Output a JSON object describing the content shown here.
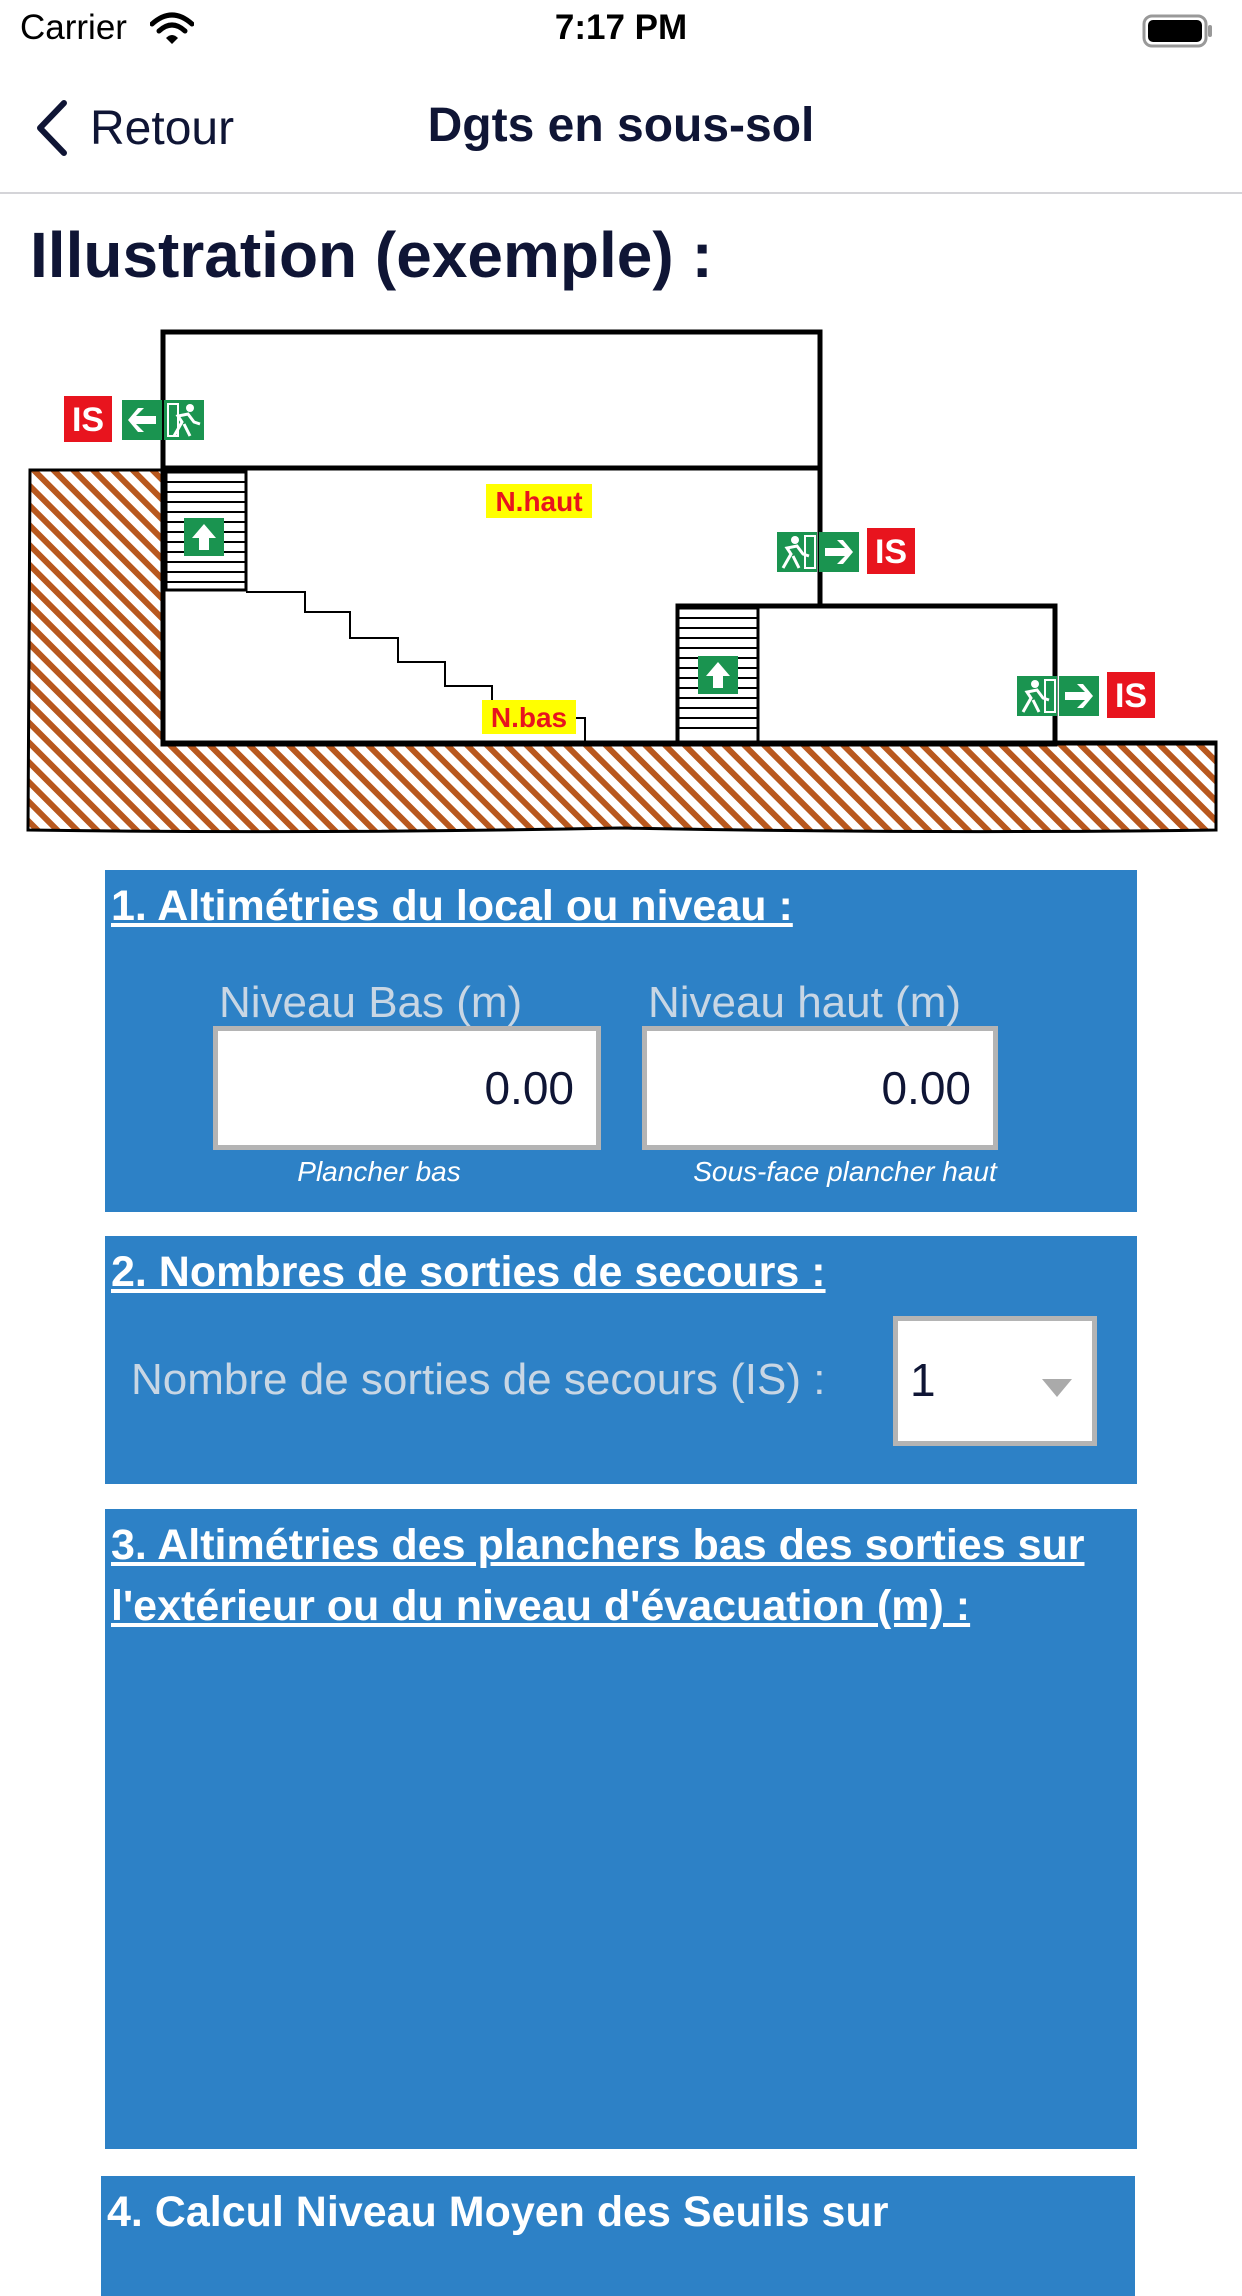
{
  "status_bar": {
    "carrier": "Carrier",
    "time": "7:17 PM"
  },
  "nav": {
    "back_label": "Retour",
    "title": "Dgts en sous-sol"
  },
  "page": {
    "section_title": "Illustration (exemple) :"
  },
  "illustration": {
    "n_haut": "N.haut",
    "n_bas": "N.bas",
    "is_label": "IS"
  },
  "section1": {
    "heading": "1. Altimétries du local ou niveau :",
    "niveau_bas": {
      "label": "Niveau Bas (m)",
      "value": "0.00",
      "hint": "Plancher bas"
    },
    "niveau_haut": {
      "label": "Niveau haut (m)",
      "value": "0.00",
      "hint": "Sous-face plancher haut"
    }
  },
  "section2": {
    "heading": "2. Nombres de sorties de secours :",
    "label": "Nombre de sorties de secours (IS) :",
    "selected": "1"
  },
  "section3": {
    "heading": "3. Altimétries des planchers bas des sorties sur l'extérieur ou du niveau d'évacuation (m) :"
  },
  "section4": {
    "heading": "4. Calcul Niveau Moyen des Seuils sur"
  },
  "colors": {
    "panel": "#2d81c6",
    "text": "#0f1535",
    "exit_green": "#1a9450",
    "is_red": "#e8141e"
  }
}
